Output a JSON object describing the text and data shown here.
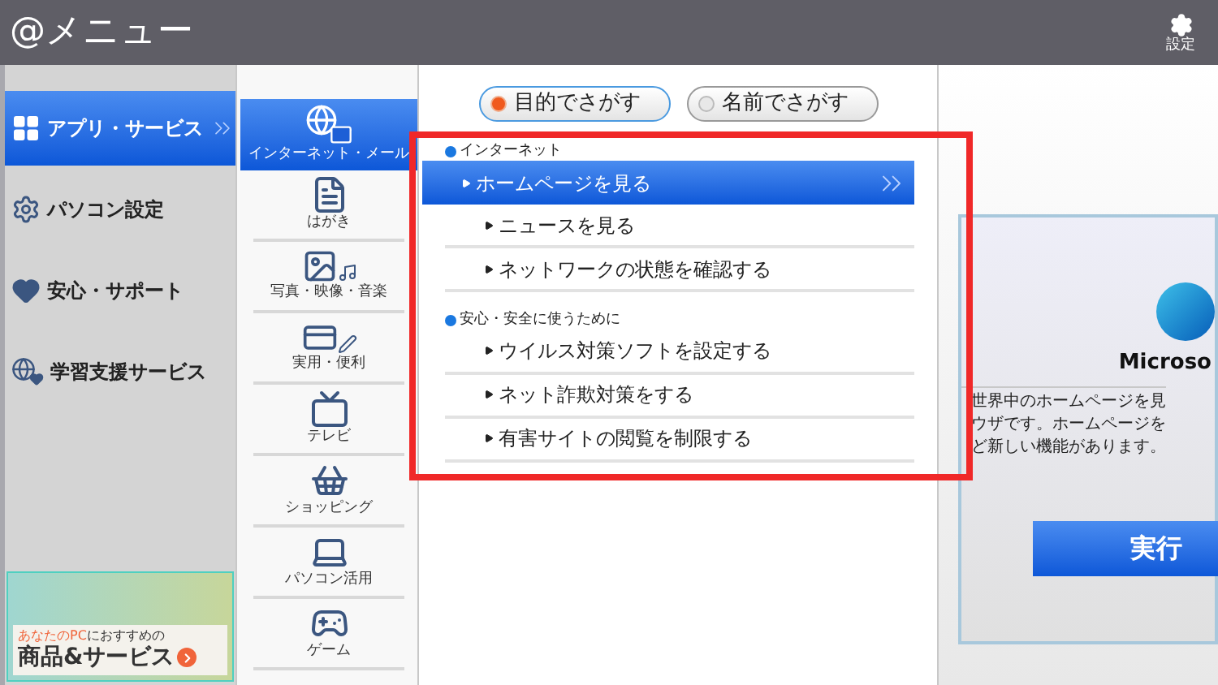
{
  "window": {
    "title": "@メニュー"
  },
  "header": {
    "settings_label": "設定"
  },
  "categories": [
    {
      "label": "アプリ・サービス",
      "selected": true
    },
    {
      "label": "パソコン設定",
      "selected": false
    },
    {
      "label": "安心・サポート",
      "selected": false
    },
    {
      "label": "学習支援サービス",
      "selected": false
    }
  ],
  "banner": {
    "highlight": "あなたのPC",
    "line": "におすすめの",
    "title": "商品&サービス"
  },
  "subcategories": [
    {
      "label": "インターネット・メール",
      "selected": true
    },
    {
      "label": "はがき",
      "selected": false
    },
    {
      "label": "写真・映像・音楽",
      "selected": false
    },
    {
      "label": "実用・便利",
      "selected": false
    },
    {
      "label": "テレビ",
      "selected": false
    },
    {
      "label": "ショッピング",
      "selected": false
    },
    {
      "label": "パソコン活用",
      "selected": false
    },
    {
      "label": "ゲーム",
      "selected": false
    }
  ],
  "search_modes": [
    {
      "label": "目的でさがす",
      "selected": true
    },
    {
      "label": "名前でさがす",
      "selected": false
    }
  ],
  "sections": [
    {
      "title": "インターネット",
      "items": [
        {
          "label": "ホームページを見る",
          "selected": true
        },
        {
          "label": "ニュースを見る",
          "selected": false
        },
        {
          "label": "ネットワークの状態を確認する",
          "selected": false
        }
      ]
    },
    {
      "title": "安心・安全に使うために",
      "items": [
        {
          "label": "ウイルス対策ソフトを設定する",
          "selected": false
        },
        {
          "label": "ネット詐欺対策をする",
          "selected": false
        },
        {
          "label": "有害サイトの閲覧を制限する",
          "selected": false
        }
      ]
    }
  ],
  "detail": {
    "title": "Microso",
    "description_lines": [
      "世界中のホームページを見",
      "ウザです。ホームページを",
      "ど新しい機能があります。"
    ],
    "button": "実行"
  }
}
